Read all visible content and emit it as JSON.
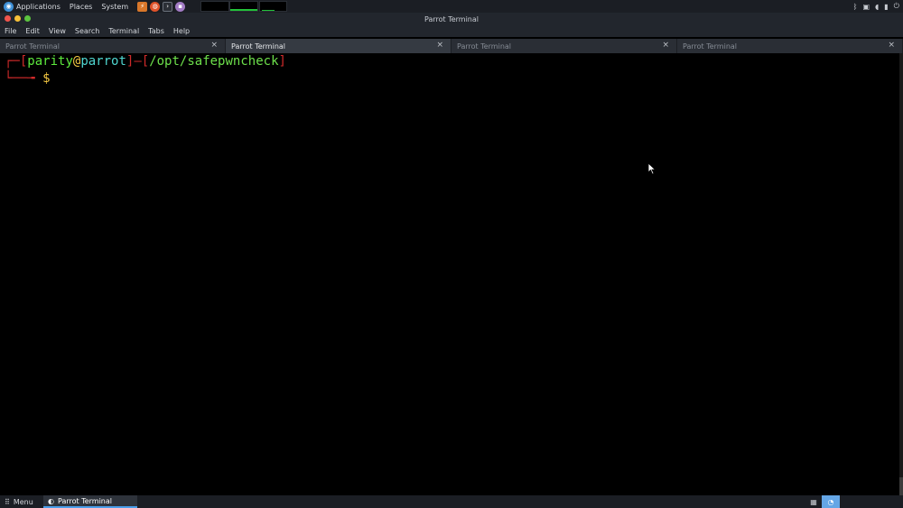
{
  "top_panel": {
    "menus": [
      "Applications",
      "Places",
      "System"
    ],
    "launchers": [
      "terminal-launcher",
      "firefox-icon",
      "terminal-icon",
      "app-icon"
    ],
    "tray_icons": [
      "bluetooth-icon",
      "network-icon",
      "volume-icon",
      "battery-icon",
      "power-icon"
    ]
  },
  "window": {
    "title": "Parrot Terminal"
  },
  "menubar": {
    "items": [
      "File",
      "Edit",
      "View",
      "Search",
      "Terminal",
      "Tabs",
      "Help"
    ]
  },
  "tabs": [
    {
      "label": "Parrot Terminal",
      "active": false
    },
    {
      "label": "Parrot Terminal",
      "active": true
    },
    {
      "label": "Parrot Terminal",
      "active": false
    },
    {
      "label": "Parrot Terminal",
      "active": false
    }
  ],
  "tab_close": "×",
  "prompt": {
    "open_bracket": "[",
    "user": "parity",
    "at": "@",
    "host": "parrot",
    "close_bracket": "]",
    "dash": "—",
    "path_open": "[",
    "path": "/opt/safepwncheck",
    "path_close": "]",
    "symbol": "$"
  },
  "bottom_panel": {
    "menu_label": "Menu",
    "task_label": "Parrot Terminal"
  },
  "colors": {
    "prompt_red": "#d02a2a",
    "user_green": "#5ce83d",
    "host_cyan": "#4fd6d0",
    "dollar_yellow": "#f5c842",
    "accent_blue": "#4a9eea"
  }
}
